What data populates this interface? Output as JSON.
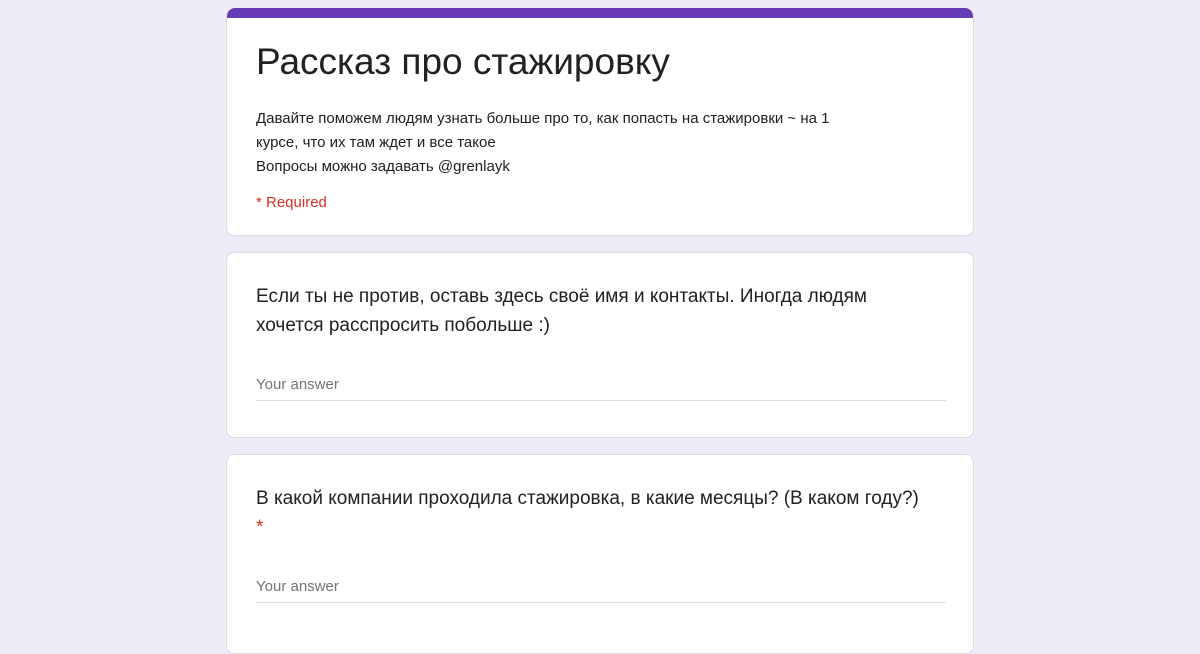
{
  "form": {
    "title": "Рассказ про стажировку",
    "description_lines": [
      "Давайте поможем людям узнать больше про то, как попасть на стажировки ~ на 1",
      "курсе, что их там ждет и все такое",
      "Вопросы можно задавать @grenlayk"
    ],
    "required_note": "* Required",
    "accent_color": "#673ab7",
    "background_color": "#efebf8",
    "required_color": "#d93025"
  },
  "questions": [
    {
      "text_lines": [
        "Если ты не против, оставь здесь своё имя и контакты. Иногда людям",
        "хочется расспросить побольше :)"
      ],
      "required": false,
      "answer_value": "",
      "placeholder": "Your answer"
    },
    {
      "text_lines": [
        "В какой компании проходила стажировка, в какие месяцы? (В каком году?)"
      ],
      "required": true,
      "required_mark": "*",
      "answer_value": "",
      "placeholder": "Your answer"
    }
  ]
}
